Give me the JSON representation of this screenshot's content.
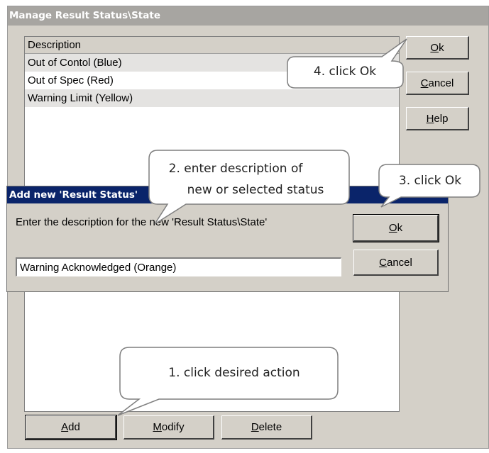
{
  "main_window": {
    "title": "Manage Result Status\\State",
    "list": {
      "header": "Description",
      "rows": [
        "Out of Contol (Blue)",
        "Out of Spec (Red)",
        "Warning Limit (Yellow)"
      ]
    },
    "buttons": {
      "ok": {
        "mnemonic": "O",
        "rest": "k"
      },
      "cancel": {
        "mnemonic": "C",
        "rest": "ancel"
      },
      "help": {
        "mnemonic": "H",
        "rest": "elp"
      },
      "add": {
        "mnemonic": "A",
        "rest": "dd"
      },
      "modify": {
        "mnemonic": "M",
        "rest": "odify"
      },
      "delete": {
        "mnemonic": "D",
        "rest": "elete"
      }
    }
  },
  "dialog": {
    "title": "Add new 'Result Status'",
    "prompt": "Enter the description for the new 'Result Status\\State'",
    "input_value": "Warning Acknowledged (Orange)",
    "buttons": {
      "ok": {
        "mnemonic": "O",
        "rest": "k"
      },
      "cancel": {
        "mnemonic": "C",
        "rest": "ancel"
      }
    }
  },
  "callouts": {
    "step1": "1. click desired action",
    "step2_line1": "2. enter description of",
    "step2_line2": "new or selected status",
    "step3": "3. click Ok",
    "step4": "4. click Ok"
  }
}
